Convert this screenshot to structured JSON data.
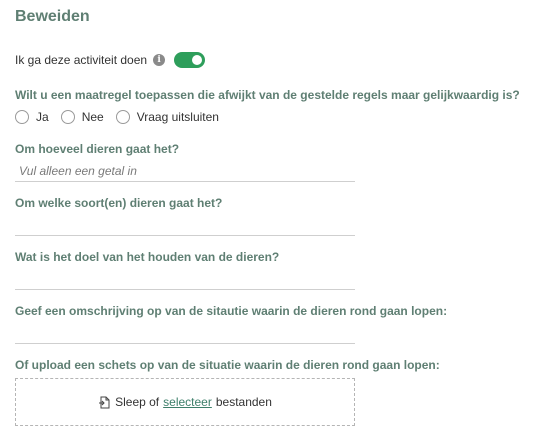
{
  "section": {
    "title": "Beweiden"
  },
  "activity": {
    "label": "Ik ga deze activiteit doen",
    "info_icon": "info-icon",
    "toggle_on": true,
    "toggle_color": "#2e9e5b"
  },
  "measure": {
    "question": "Wilt u een maatregel toepassen die afwijkt van de gestelde regels maar gelijkwaardig is?",
    "options": [
      "Ja",
      "Nee",
      "Vraag uitsluiten"
    ]
  },
  "animal_count": {
    "question": "Om hoeveel dieren gaat het?",
    "placeholder": "Vul alleen een getal in",
    "value": ""
  },
  "animal_species": {
    "question": "Om welke soort(en) dieren gaat het?",
    "value": ""
  },
  "purpose": {
    "question": "Wat is het doel van het houden van de dieren?",
    "value": ""
  },
  "description": {
    "question": "Geef een omschrijving op van de sitautie waarin de dieren rond gaan lopen:",
    "value": ""
  },
  "upload": {
    "question": "Of upload een schets op van de situatie waarin de dieren rond gaan lopen:",
    "text_before": "Sleep of",
    "link_text": "selecteer",
    "text_after": "bestanden",
    "icon": "file-upload-icon"
  },
  "colors": {
    "heading": "#5f7f73",
    "link": "#3d7f6a"
  }
}
